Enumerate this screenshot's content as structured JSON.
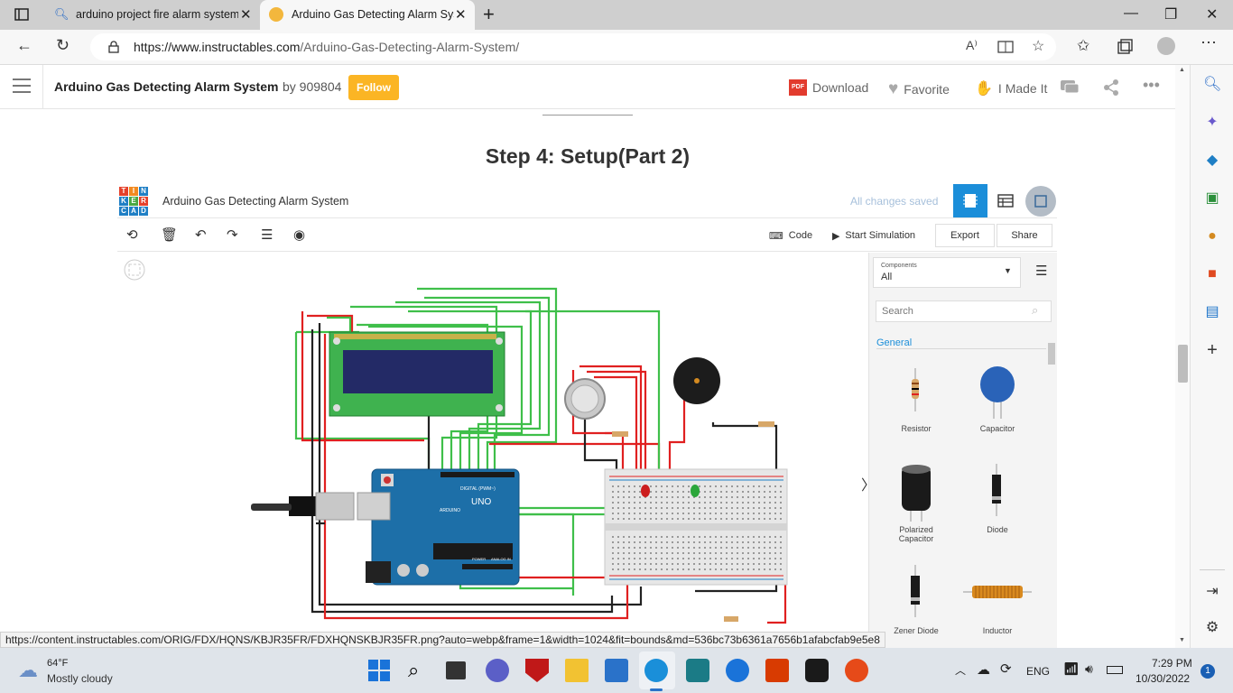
{
  "browser": {
    "tabs": [
      {
        "title": "arduino project fire alarm system",
        "close": "✕"
      },
      {
        "title": "Arduino Gas Detecting Alarm Sys",
        "close": "✕"
      }
    ],
    "new_tab": "+",
    "url_host": "https://www.instructables.com",
    "url_path": "/Arduino-Gas-Detecting-Alarm-System/",
    "read_aloud": "A⁾"
  },
  "site": {
    "title": "Arduino Gas Detecting Alarm System",
    "by": "by 909804",
    "follow": "Follow",
    "download": "Download",
    "favorite": "Favorite",
    "made_it": "I Made It"
  },
  "step": {
    "title": "Step 4: Setup(Part 2)"
  },
  "tinkercad": {
    "logo_letters": [
      "T",
      "I",
      "N",
      "K",
      "E",
      "R",
      "C",
      "A",
      "D"
    ],
    "design_name": "Arduino Gas Detecting Alarm System",
    "saved": "All changes saved",
    "code": "Code",
    "start_sim": "Start Simulation",
    "export": "Export",
    "share": "Share",
    "components_label": "Components",
    "components_value": "All",
    "search_placeholder": "Search",
    "general": "General",
    "parts": [
      "Resistor",
      "Capacitor",
      "Polarized Capacitor",
      "Diode",
      "Zener Diode",
      "Inductor"
    ],
    "uno": "UNO",
    "arduino": "ARDUINO",
    "digital": "DIGITAL (PWM~)",
    "power": "POWER",
    "analog": "ANALOG IN",
    "collapse": "〉"
  },
  "status_url": "https://content.instructables.com/ORIG/FDX/HQNS/KBJR35FR/FDXHQNSKBJR35FR.png?auto=webp&frame=1&width=1024&fit=bounds&md=536bc73b6361a7656b1afabcfab9e5e8",
  "taskbar": {
    "temp": "64°F",
    "weather": "Mostly cloudy",
    "lang": "ENG",
    "time": "7:29 PM",
    "date": "10/30/2022",
    "notif": "1"
  },
  "colors": {
    "follow": "#fbb524",
    "tinker_blue": "#1b8ed9",
    "wire_green": "#3fbf4a",
    "wire_red": "#e02020"
  }
}
